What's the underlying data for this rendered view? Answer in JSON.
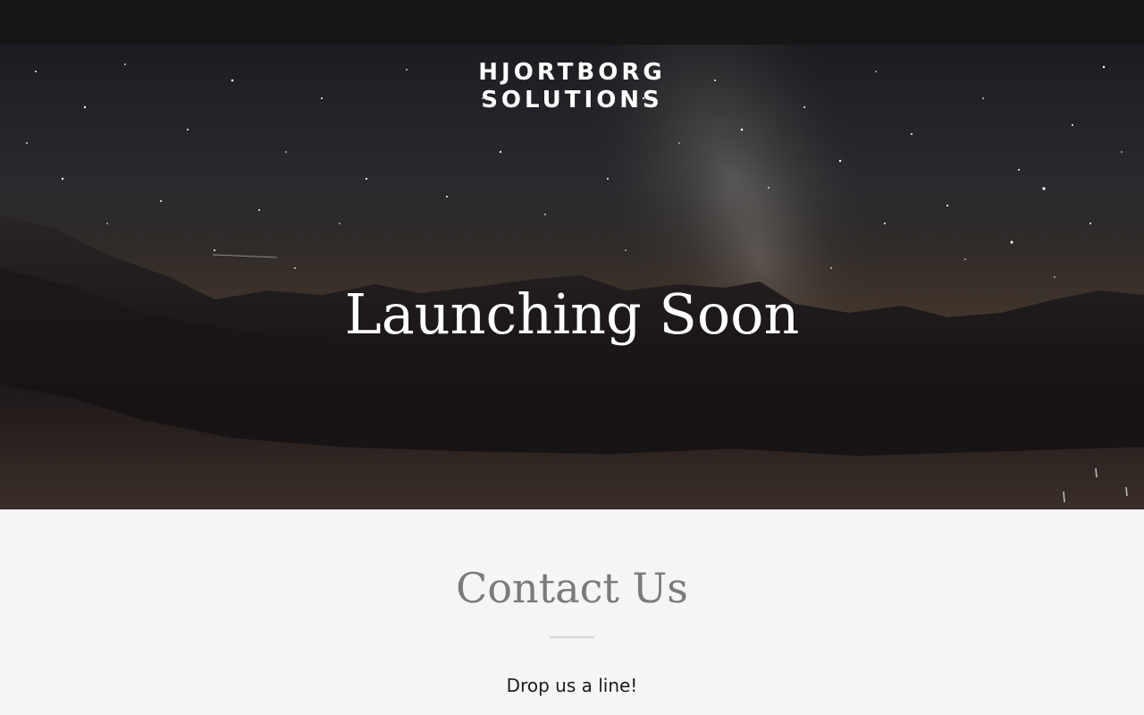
{
  "site": {
    "brand_line1": "HJORTBORG",
    "brand_line2": "SOLUTIONS"
  },
  "hero": {
    "headline": "Launching Soon",
    "background": "night-sky-mountain-lake-image"
  },
  "contact": {
    "title": "Contact Us",
    "subtitle": "Drop us a line!"
  },
  "colors": {
    "topbar": "#161616",
    "hero_text": "#ffffff",
    "section_bg": "#f5f5f5",
    "section_title": "#7a7a7a",
    "divider": "#d6d6d6",
    "body_text": "#1b1b1b"
  }
}
